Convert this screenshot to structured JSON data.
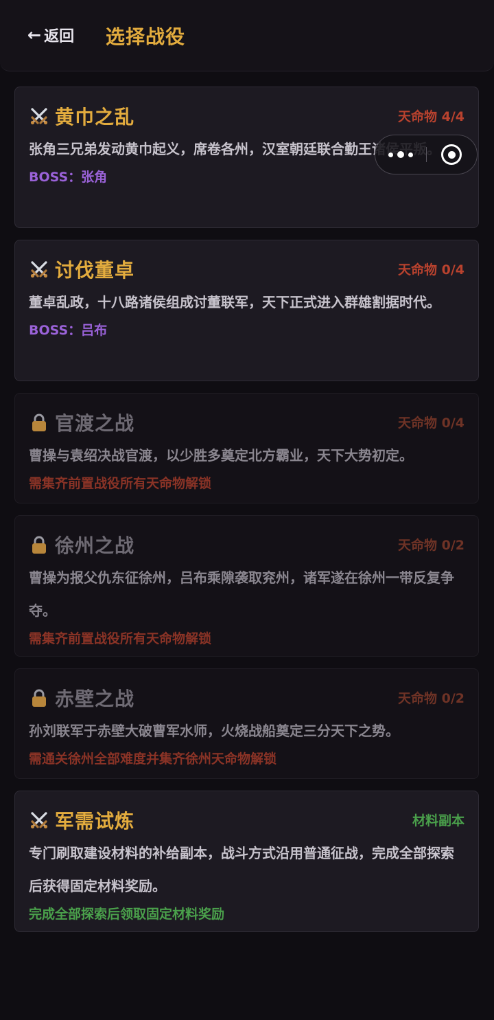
{
  "header": {
    "back_label": "返回",
    "title": "选择战役"
  },
  "campaigns": [
    {
      "title": "黄巾之乱",
      "tag": "天命物 4/4",
      "desc": "张角三兄弟发动黄巾起义，席卷各州，汉室朝廷联合勤王诸侯平叛。",
      "foot": "BOSS：张角",
      "status": "unlocked"
    },
    {
      "title": "讨伐董卓",
      "tag": "天命物 0/4",
      "desc": "董卓乱政，十八路诸侯组成讨董联军，天下正式进入群雄割据时代。",
      "foot": "BOSS：吕布",
      "status": "unlocked"
    },
    {
      "title": "官渡之战",
      "tag": "天命物 0/4",
      "desc": "曹操与袁绍决战官渡，以少胜多奠定北方霸业，天下大势初定。",
      "foot": "需集齐前置战役所有天命物解锁",
      "status": "locked"
    },
    {
      "title": "徐州之战",
      "tag": "天命物 0/2",
      "desc": "曹操为报父仇东征徐州，吕布乘隙袭取兖州，诸军遂在徐州一带反复争夺。",
      "foot": "需集齐前置战役所有天命物解锁",
      "status": "locked"
    },
    {
      "title": "赤壁之战",
      "tag": "天命物 0/2",
      "desc": "孙刘联军于赤壁大破曹军水师，火烧战船奠定三分天下之势。",
      "foot": "需通关徐州全部难度并集齐徐州天命物解锁",
      "status": "locked"
    },
    {
      "title": "军需试炼",
      "tag": "材料副本",
      "desc": "专门刷取建设材料的补给副本，战斗方式沿用普通征战，完成全部探索后获得固定材料奖励。",
      "foot": "完成全部探索后领取固定材料奖励",
      "status": "unlocked"
    }
  ],
  "icons": {
    "unlocked": "crossed-swords-icon",
    "locked": "lock-icon"
  },
  "colors": {
    "background": "#0f0d12",
    "accent_gold": "#e3ac3e",
    "tag_red": "#b9422e",
    "boss_purple": "#9a62d8",
    "green": "#4aa04b"
  }
}
